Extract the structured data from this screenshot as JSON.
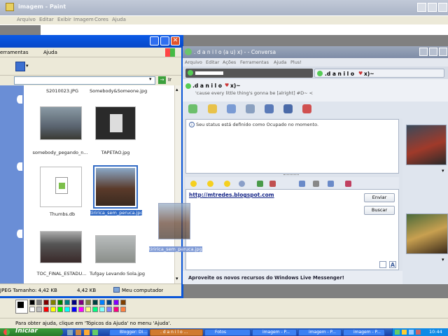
{
  "paint": {
    "title": "imagem - Paint",
    "menu": [
      "Arquivo",
      "Editar",
      "Exibir",
      "Imagem",
      "Cores",
      "Ajuda"
    ],
    "status_text": "Para obter ajuda, clique em 'Tópicos da Ajuda' no menu 'Ajuda'.",
    "palette": [
      "#000000",
      "#808080",
      "#800000",
      "#808000",
      "#008000",
      "#008080",
      "#000080",
      "#800080",
      "#808040",
      "#004040",
      "#0080ff",
      "#004080",
      "#8000ff",
      "#804000",
      "#ffffff",
      "#c0c0c0",
      "#ff0000",
      "#ffff00",
      "#00ff00",
      "#00ffff",
      "#0000ff",
      "#ff00ff",
      "#ffff80",
      "#00ff80",
      "#80ffff",
      "#8080ff",
      "#ff0080",
      "#ff8040"
    ]
  },
  "explorer": {
    "menu": [
      "erramentas",
      "Ajuda"
    ],
    "go_label": "Ir",
    "files": [
      {
        "name": "S2010023.JPG"
      },
      {
        "name": "Somebody&Someone.jpg"
      },
      {
        "name": "somebody_pegando_n..."
      },
      {
        "name": "TAPETAO.jpg"
      },
      {
        "name": "Thumbs.db"
      },
      {
        "name": "tiririca_sem_peruca.jpg"
      },
      {
        "name": "TOC_FINAL_ESTADU..."
      },
      {
        "name": "Tufgay Levando Sola.jpg"
      }
    ],
    "drag_label": "tiririca_sem_peruca.jpg",
    "status_type": "JPEG Tamanho: 4,42 KB",
    "status_size": "4,42 KB",
    "status_location": "Meu computador"
  },
  "messenger": {
    "title": ". d a n i l o  (a u)  x) - - Conversa",
    "menu": [
      "Arquivo",
      "Editar",
      "Ações",
      "Ferramentas",
      "Ajuda",
      "Plus!"
    ],
    "tab_contact": ".d a n i l o",
    "tab_suffix": "x)~",
    "contact_name": ".d a n i l o",
    "contact_suffix": "x)~",
    "personal_message": "'cause every little thing's gonna be [alright] #D~ <",
    "status_notice": "Seu status está definido como Ocupado no momento.",
    "input_text": "http://mtredes.blogspot.com",
    "send_label": "Enviar",
    "search_label": "Buscar",
    "promo": "Aproveite os novos recursos do Windows Live Messenger!"
  },
  "taskbar": {
    "start_label": "Iniciar",
    "buttons": [
      "Blogger: Di...",
      ". d a n i l o ...",
      "Fotos",
      "imagem - P...",
      "imagem - P...",
      "imagem - P..."
    ],
    "time": "10:44"
  }
}
